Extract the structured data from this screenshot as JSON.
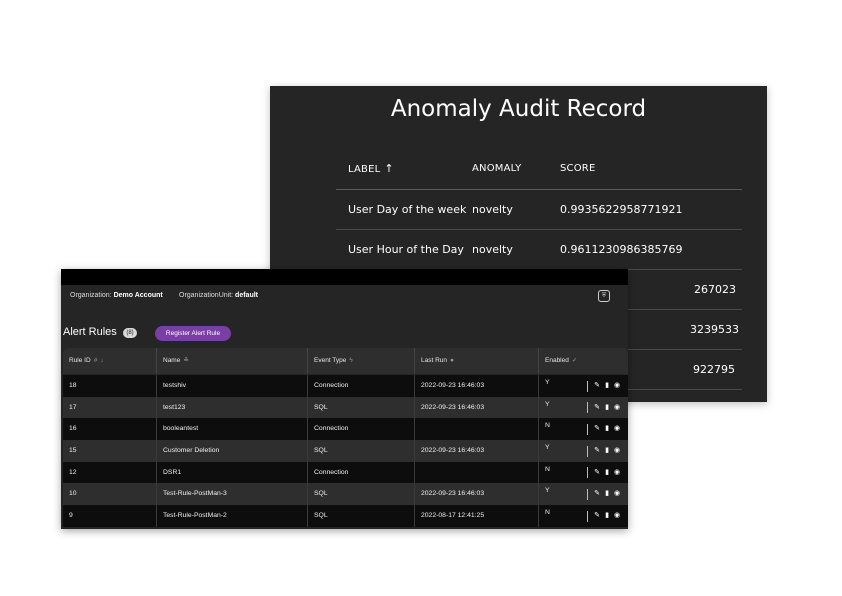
{
  "audit": {
    "title": "Anomaly Audit Record",
    "columns": [
      "LABEL",
      "ANOMALY",
      "SCORE"
    ],
    "sort_icon": "arrow-up-icon",
    "rows": [
      {
        "label": "User Day of the week",
        "anomaly": "novelty",
        "score": "0.9935622958771921"
      },
      {
        "label": "User Hour of the Day",
        "anomaly": "novelty",
        "score": "0.9611230986385769"
      },
      {
        "label": "",
        "anomaly": "",
        "score": "267023"
      },
      {
        "label": "",
        "anomaly": "",
        "score": "3239533"
      },
      {
        "label": "",
        "anomaly": "",
        "score": "922795"
      }
    ]
  },
  "rules": {
    "org_label": "Organization:",
    "org_value": "Demo Account",
    "unit_label": "OrganizationUnit:",
    "unit_value": "default",
    "title": "Alert Rules",
    "count": "(8)",
    "register_label": "Register Alert Rule",
    "columns": [
      "Rule ID",
      "Name",
      "Event Type",
      "Last Run",
      "Enabled"
    ],
    "rows": [
      {
        "id": "18",
        "name": "testshiv",
        "event": "Connection",
        "last_run": "2022-09-23 16:46:03",
        "enabled": "Y"
      },
      {
        "id": "17",
        "name": "test123",
        "event": "SQL",
        "last_run": "2022-09-23 16:46:03",
        "enabled": "Y"
      },
      {
        "id": "16",
        "name": "booleantest",
        "event": "Connection",
        "last_run": "",
        "enabled": "N"
      },
      {
        "id": "15",
        "name": "Customer Deletion",
        "event": "SQL",
        "last_run": "2022-09-23 16:46:03",
        "enabled": "Y"
      },
      {
        "id": "12",
        "name": "DSR1",
        "event": "Connection",
        "last_run": "",
        "enabled": "N"
      },
      {
        "id": "10",
        "name": "Test-Rule-PostMan-3",
        "event": "SQL",
        "last_run": "2022-09-23 16:46:03",
        "enabled": "Y"
      },
      {
        "id": "9",
        "name": "Test-Rule-PostMan-2",
        "event": "SQL",
        "last_run": "2022-08-17 12:41:25",
        "enabled": "N"
      }
    ]
  },
  "colors": {
    "panel_bg": "#252525",
    "row_dark": "#0d0d0d",
    "row_light": "#2e2e2e",
    "accent_purple": "#7a3fa4"
  }
}
